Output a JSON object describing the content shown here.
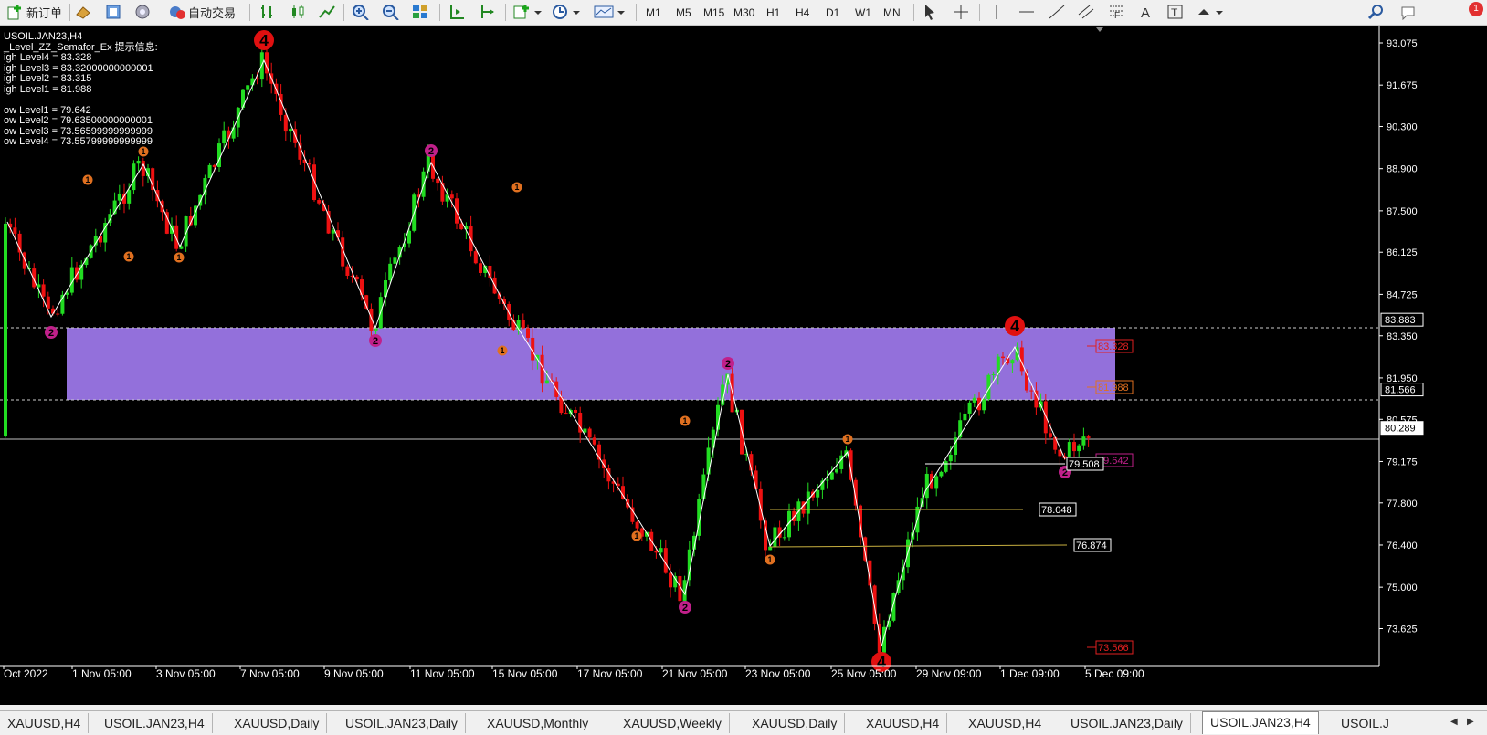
{
  "toolbar": {
    "new_order_label": "新订单",
    "auto_trading_label": "自动交易",
    "timeframes": [
      "M1",
      "M5",
      "M15",
      "M30",
      "H1",
      "H4",
      "D1",
      "W1",
      "MN"
    ],
    "notification_count": "1"
  },
  "chart": {
    "symbol_header": "USOIL.JAN23,H4",
    "indicator_header": "_Level_ZZ_Semafor_Ex 提示信息:",
    "info_lines": [
      "igh Level4 = 83.328",
      "igh Level3 = 83.32000000000001",
      "igh Level2 = 83.315",
      "igh Level1 = 81.988",
      "",
      "ow Level1 = 79.642",
      "ow Level2 = 79.63500000000001",
      "ow Level3 = 73.56599999999999",
      "ow Level4 = 73.55799999999999"
    ],
    "price_axis": [
      "93.075",
      "91.675",
      "90.300",
      "88.900",
      "87.500",
      "86.125",
      "84.725",
      "83.883",
      "83.350",
      "81.950",
      "81.566",
      "80.575",
      "80.289",
      "79.175",
      "77.800",
      "76.400",
      "75.000",
      "73.625"
    ],
    "time_axis": [
      "Oct 2022",
      "1 Nov 05:00",
      "3 Nov 05:00",
      "7 Nov 05:00",
      "9 Nov 05:00",
      "11 Nov 05:00",
      "15 Nov 05:00",
      "17 Nov 05:00",
      "21 Nov 05:00",
      "23 Nov 05:00",
      "25 Nov 05:00",
      "29 Nov 09:00",
      "1 Dec 09:00",
      "5 Dec 09:00"
    ],
    "current_price": "80.289",
    "zone_top_label": "83.883",
    "zone_bottom_label": "81.566",
    "level_labels": [
      "83.328",
      "81.988",
      "79.642",
      "73.566"
    ],
    "line_labels": [
      "79.508",
      "78.048",
      "76.874"
    ],
    "colors": {
      "bull": "#22dd22",
      "bear": "#ee1111",
      "zone": "#9370db",
      "zigzag": "#ffffff"
    }
  },
  "tabs": [
    "XAUUSD,H4",
    "USOIL.JAN23,H4",
    "XAUUSD,Daily",
    "USOIL.JAN23,Daily",
    "XAUUSD,Monthly",
    "XAUUSD,Weekly",
    "XAUUSD,Daily",
    "XAUUSD,H4",
    "XAUUSD,H4",
    "USOIL.JAN23,Daily",
    "USOIL.JAN23,H4",
    "USOIL.J"
  ],
  "active_tab": "USOIL.JAN23,H4"
}
